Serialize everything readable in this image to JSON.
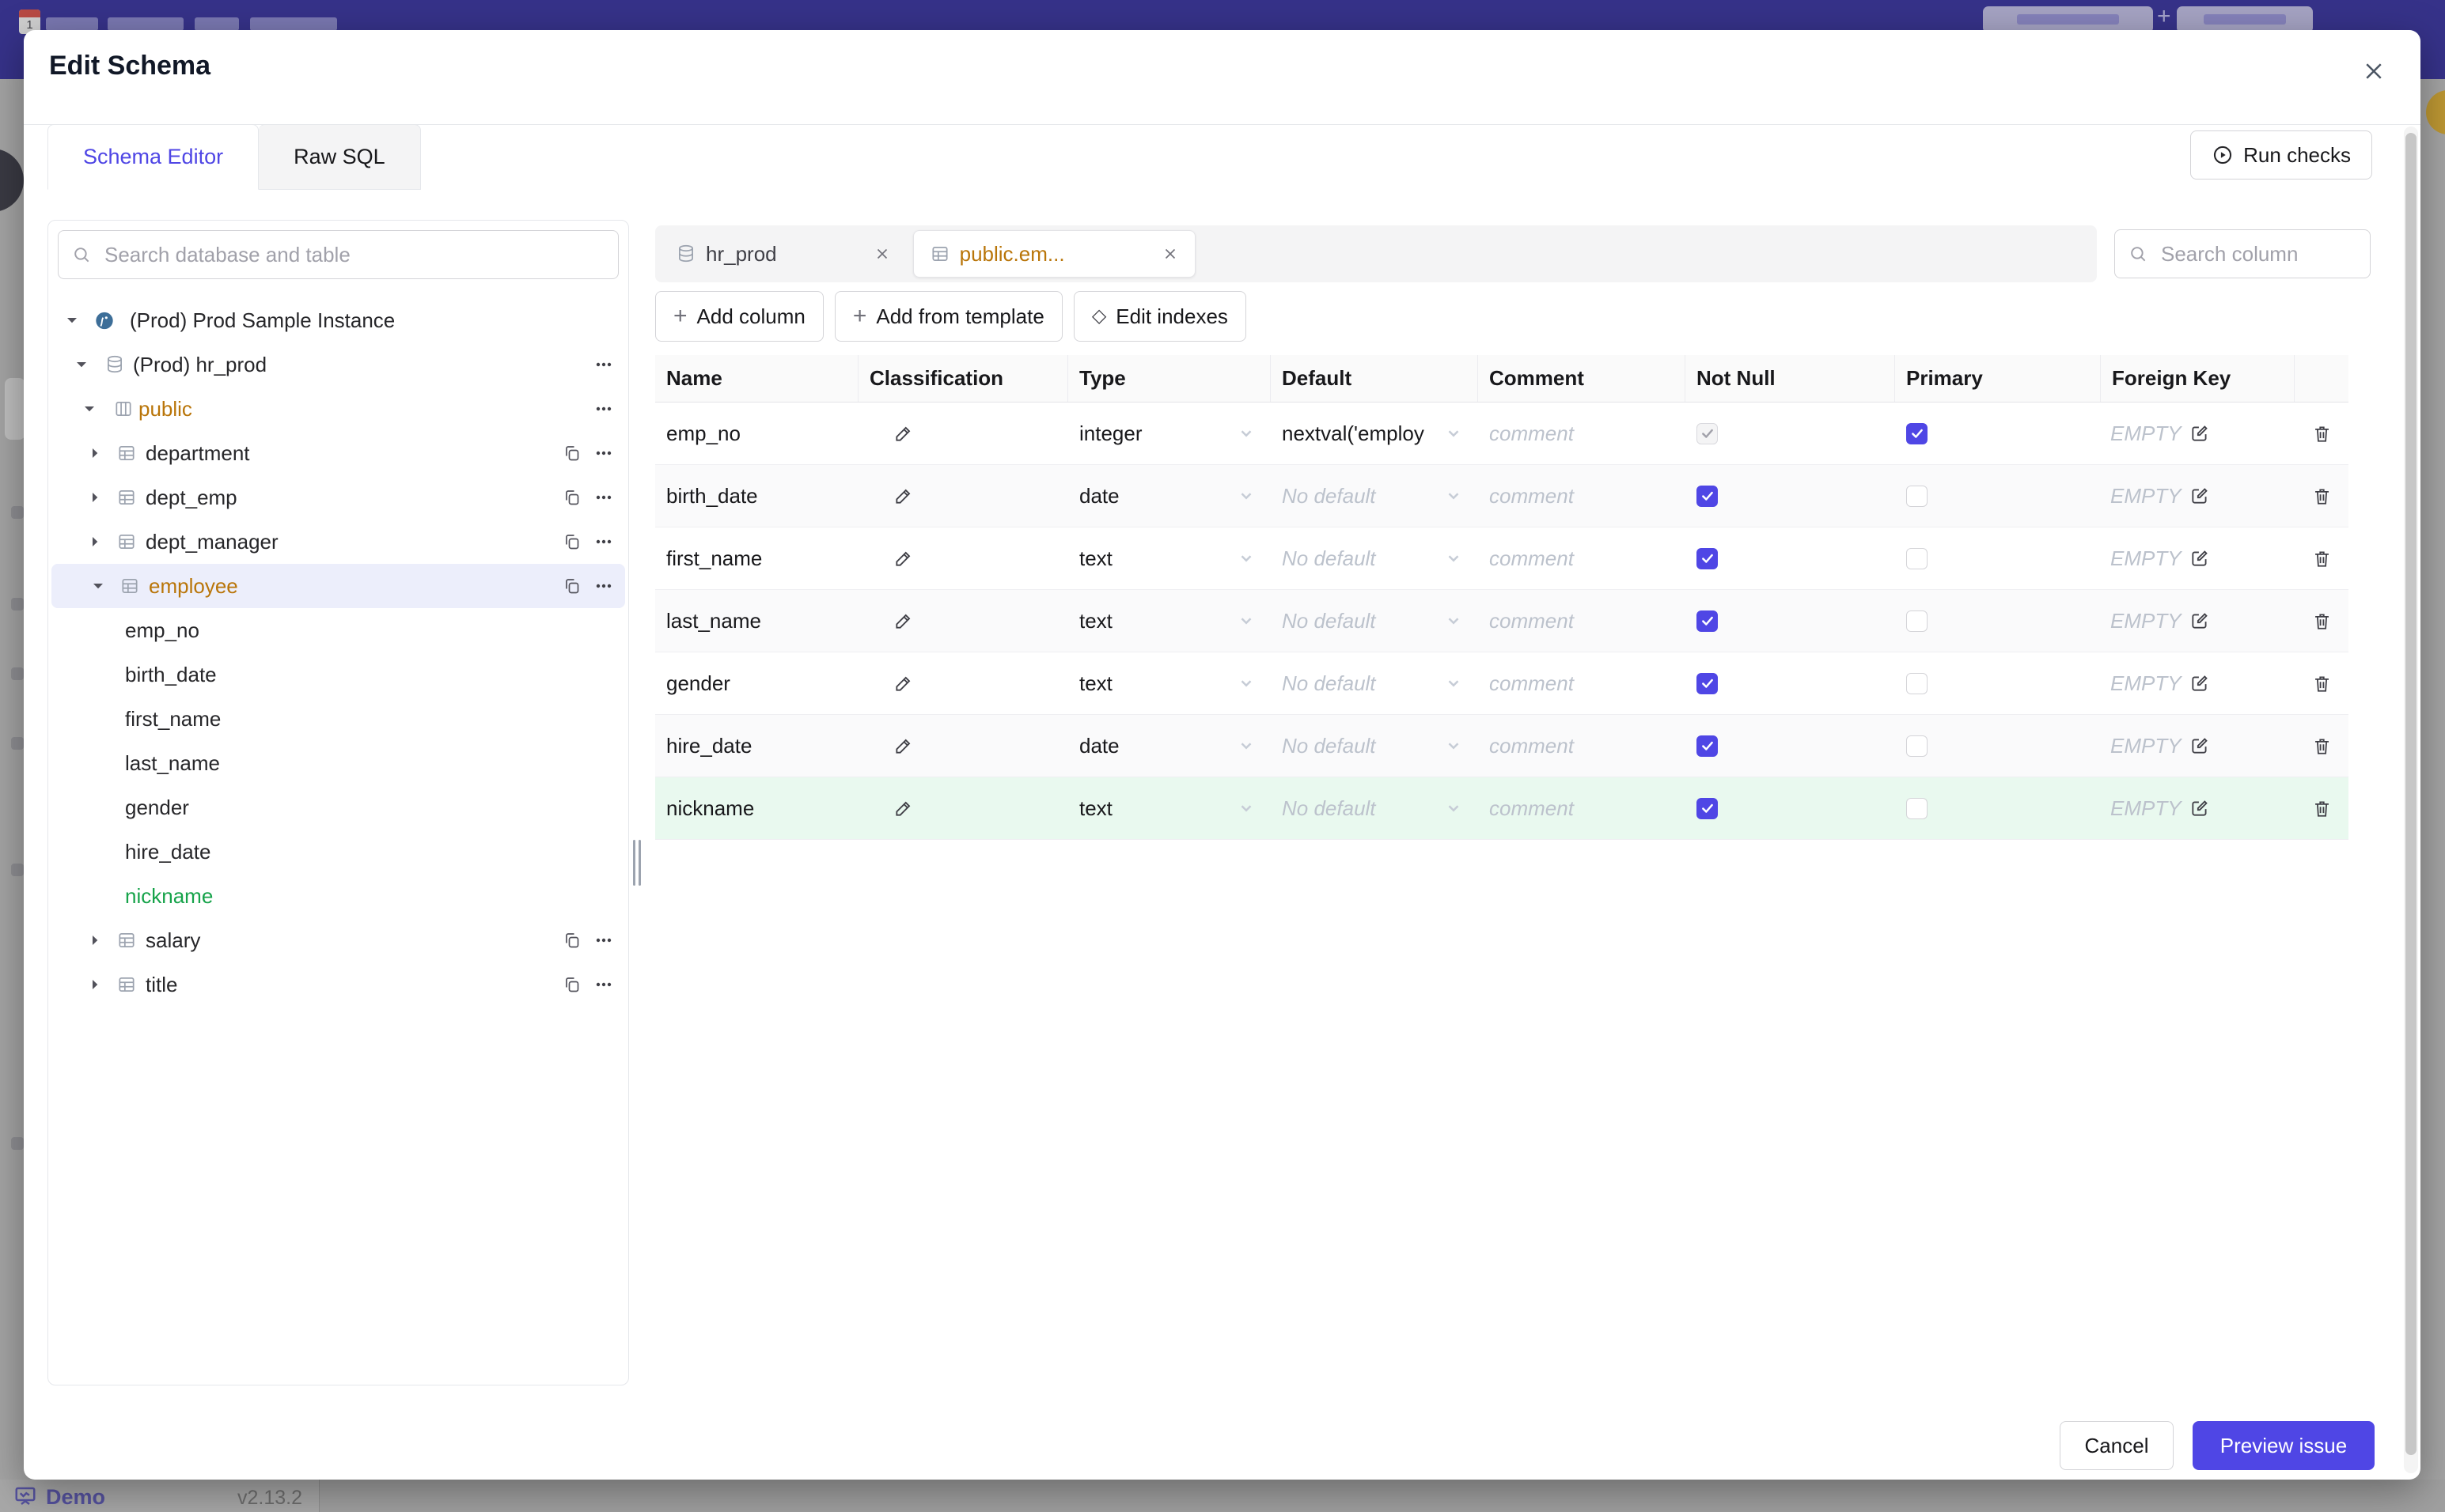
{
  "colors": {
    "accent": "#4f46e5",
    "amber_changed": "#b97509",
    "green_new": "#16a34a",
    "topbar_dimmed": "#363289",
    "selected_row_bg": "#eceefb",
    "new_row_bg": "#e9f9ef"
  },
  "modal": {
    "title": "Edit Schema",
    "tabs": [
      {
        "label": "Schema Editor",
        "active": true
      },
      {
        "label": "Raw SQL",
        "active": false
      }
    ],
    "run_checks_label": "Run checks"
  },
  "sidebar": {
    "search_placeholder": "Search database and table",
    "tree": [
      {
        "label": "(Prod) Prod Sample Instance",
        "level": 0,
        "icon": "postgres",
        "caret": "down",
        "color": "default",
        "selected": false,
        "copy": false,
        "menu": false
      },
      {
        "label": "(Prod) hr_prod",
        "level": 1,
        "icon": "database",
        "caret": "down",
        "color": "default",
        "selected": false,
        "copy": false,
        "menu": true
      },
      {
        "label": "public",
        "level": 2,
        "icon": "schema",
        "caret": "down",
        "color": "amber",
        "selected": false,
        "copy": false,
        "menu": true
      },
      {
        "label": "department",
        "level": 3,
        "icon": "table",
        "caret": "right",
        "color": "default",
        "selected": false,
        "copy": true,
        "menu": true
      },
      {
        "label": "dept_emp",
        "level": 3,
        "icon": "table",
        "caret": "right",
        "color": "default",
        "selected": false,
        "copy": true,
        "menu": true
      },
      {
        "label": "dept_manager",
        "level": 3,
        "icon": "table",
        "caret": "right",
        "color": "default",
        "selected": false,
        "copy": true,
        "menu": true
      },
      {
        "label": "employee",
        "level": 3,
        "icon": "table",
        "caret": "down",
        "color": "amber",
        "selected": true,
        "copy": true,
        "menu": true
      },
      {
        "label": "emp_no",
        "level": 4,
        "icon": null,
        "caret": null,
        "color": "default",
        "selected": false,
        "copy": false,
        "menu": false
      },
      {
        "label": "birth_date",
        "level": 4,
        "icon": null,
        "caret": null,
        "color": "default",
        "selected": false,
        "copy": false,
        "menu": false
      },
      {
        "label": "first_name",
        "level": 4,
        "icon": null,
        "caret": null,
        "color": "default",
        "selected": false,
        "copy": false,
        "menu": false
      },
      {
        "label": "last_name",
        "level": 4,
        "icon": null,
        "caret": null,
        "color": "default",
        "selected": false,
        "copy": false,
        "menu": false
      },
      {
        "label": "gender",
        "level": 4,
        "icon": null,
        "caret": null,
        "color": "default",
        "selected": false,
        "copy": false,
        "menu": false
      },
      {
        "label": "hire_date",
        "level": 4,
        "icon": null,
        "caret": null,
        "color": "default",
        "selected": false,
        "copy": false,
        "menu": false
      },
      {
        "label": "nickname",
        "level": 4,
        "icon": null,
        "caret": null,
        "color": "green",
        "selected": false,
        "copy": false,
        "menu": false
      },
      {
        "label": "salary",
        "level": 3,
        "icon": "table",
        "caret": "right",
        "color": "default",
        "selected": false,
        "copy": true,
        "menu": true
      },
      {
        "label": "title",
        "level": 3,
        "icon": "table",
        "caret": "right",
        "color": "default",
        "selected": false,
        "copy": true,
        "menu": true
      }
    ]
  },
  "editor": {
    "chips": [
      {
        "label": "hr_prod",
        "icon": "database",
        "active": false
      },
      {
        "label": "public.em...",
        "icon": "table",
        "active": true
      }
    ],
    "actions": [
      {
        "icon": "plus",
        "label": "Add column"
      },
      {
        "icon": "plus",
        "label": "Add from template"
      },
      {
        "icon": "diamond",
        "label": "Edit indexes"
      }
    ],
    "column_search_placeholder": "Search column"
  },
  "table": {
    "headers": [
      "Name",
      "Classification",
      "Type",
      "Default",
      "Comment",
      "Not Null",
      "Primary",
      "Foreign Key"
    ],
    "comment_placeholder": "comment",
    "rows": [
      {
        "name": "emp_no",
        "type": "integer",
        "default_value": "nextval('employ",
        "default_is_placeholder": false,
        "not_null": true,
        "not_null_disabled": true,
        "primary": true,
        "foreign_key": "EMPTY",
        "bg": "white"
      },
      {
        "name": "birth_date",
        "type": "date",
        "default_value": "No default",
        "default_is_placeholder": true,
        "not_null": true,
        "not_null_disabled": false,
        "primary": false,
        "foreign_key": "EMPTY",
        "bg": "stripe"
      },
      {
        "name": "first_name",
        "type": "text",
        "default_value": "No default",
        "default_is_placeholder": true,
        "not_null": true,
        "not_null_disabled": false,
        "primary": false,
        "foreign_key": "EMPTY",
        "bg": "white"
      },
      {
        "name": "last_name",
        "type": "text",
        "default_value": "No default",
        "default_is_placeholder": true,
        "not_null": true,
        "not_null_disabled": false,
        "primary": false,
        "foreign_key": "EMPTY",
        "bg": "stripe"
      },
      {
        "name": "gender",
        "type": "text",
        "default_value": "No default",
        "default_is_placeholder": true,
        "not_null": true,
        "not_null_disabled": false,
        "primary": false,
        "foreign_key": "EMPTY",
        "bg": "white"
      },
      {
        "name": "hire_date",
        "type": "date",
        "default_value": "No default",
        "default_is_placeholder": true,
        "not_null": true,
        "not_null_disabled": false,
        "primary": false,
        "foreign_key": "EMPTY",
        "bg": "stripe"
      },
      {
        "name": "nickname",
        "type": "text",
        "default_value": "No default",
        "default_is_placeholder": true,
        "not_null": true,
        "not_null_disabled": false,
        "primary": false,
        "foreign_key": "EMPTY",
        "bg": "green"
      }
    ]
  },
  "footer": {
    "cancel_label": "Cancel",
    "preview_label": "Preview issue"
  },
  "statusbar": {
    "demo_label": "Demo",
    "version": "v2.13.2"
  }
}
